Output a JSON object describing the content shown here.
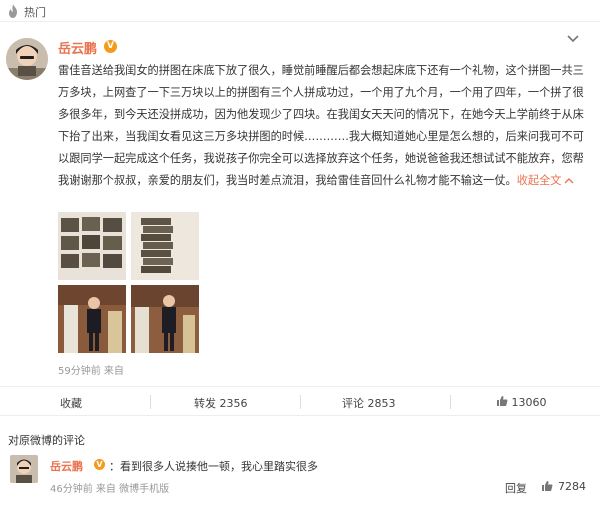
{
  "hot": {
    "label": "热门",
    "icon": "fire-icon"
  },
  "post": {
    "user_name": "岳云鹏",
    "verified_badge": "V",
    "body_text": "雷佳音送给我闺女的拼图在床底下放了很久，睡觉前睡醒后都会想起床底下还有一个礼物，这个拼图一共三万多块，上网查了一下三万块以上的拼图有三个人拼成功过，一个用了九个月，一个用了四年，一个拼了很多很多年，到今天还没拼成功，因为他发现少了四块。在我闺女天天问的情况下，在她今天上学前终于从床下抬了出来，当我闺女看见这三万多块拼图的时候…………我大概知道她心里是怎么想的，后来问我可不可以跟同学一起完成这个任务，我说孩子你完全可以选择放弃这个任务，她说爸爸我还想试试不能放弃，您帮我谢谢那个叔叔，亲爱的朋友们，我当时差点流泪，我给雷佳音回什么礼物才能不输这一仗。",
    "collapse_label": "收起全文",
    "time_source": "59分钟前 来自"
  },
  "actions": {
    "favorite_label": "收藏",
    "repost_label": "转发 2356",
    "comment_label": "评论 2853",
    "like_count": "13060"
  },
  "comments": {
    "section_title": "对原微博的评论",
    "items": [
      {
        "user": "岳云鹏",
        "verified_badge": "V",
        "separator": "：",
        "text": "看到很多人说揍他一顿，我心里踏实很多",
        "meta": "46分钟前 来自  微博手机版",
        "reply_label": "回复",
        "like_count": "7284"
      }
    ]
  },
  "colors": {
    "accent": "#eb7350",
    "badge": "#f59b1c",
    "muted": "#999999",
    "text": "#333333"
  }
}
